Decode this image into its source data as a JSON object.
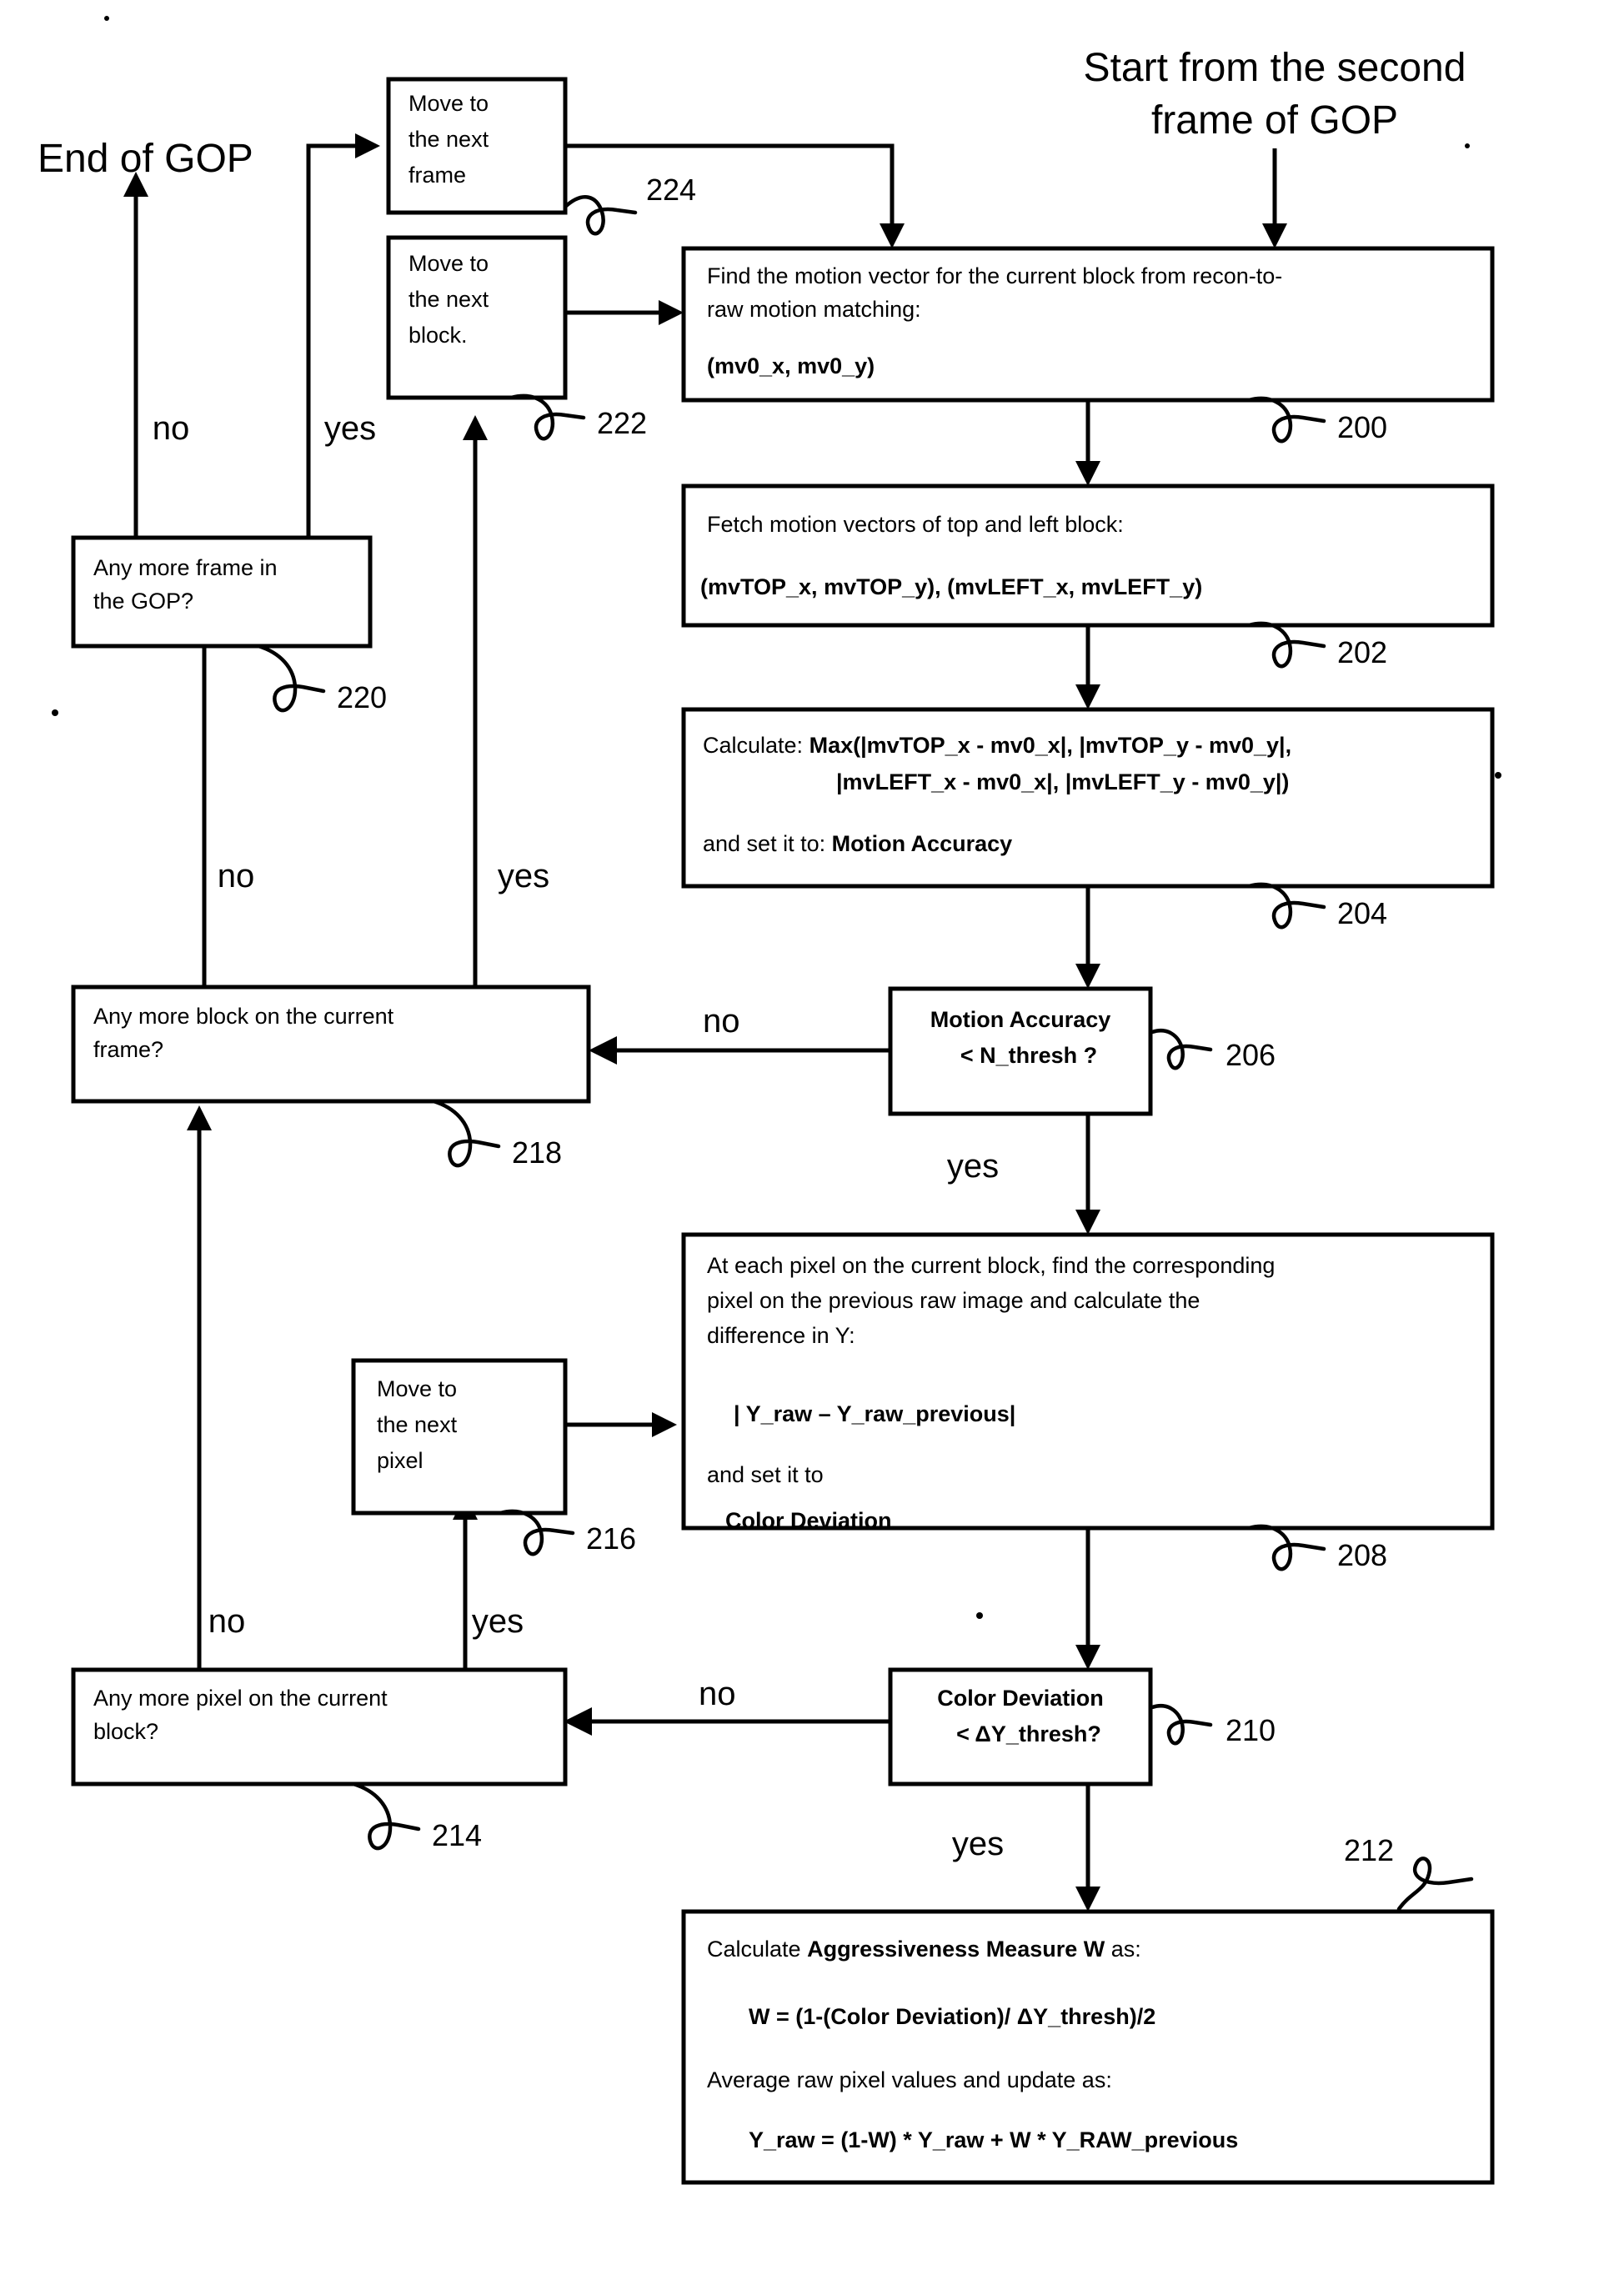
{
  "diagram": {
    "title_start": "Start from the second frame of GOP",
    "title_end": "End of GOP",
    "nodes": {
      "move_frame": {
        "ref": "224",
        "lines": [
          "Move to",
          "the next",
          "frame"
        ]
      },
      "move_block": {
        "ref": "222",
        "lines": [
          "Move to",
          "the next",
          "block."
        ]
      },
      "move_pixel": {
        "ref": "216",
        "lines": [
          "Move to",
          "the next",
          "pixel"
        ]
      },
      "step200": {
        "ref": "200",
        "lines": [
          "Find the motion vector for the current block from recon-to-",
          "raw motion matching:",
          "",
          "(mv0_x, mv0_y)"
        ]
      },
      "step202": {
        "ref": "202",
        "lines": [
          " Fetch motion vectors of top and left block:",
          "",
          "(mvTOP_x, mvTOP_y),  (mvLEFT_x, mvLEFT_y)"
        ]
      },
      "step204": {
        "ref": "204",
        "line1_plain": "Calculate:  ",
        "line1_bold": "Max(|mvTOP_x -  mv0_x|, |mvTOP_y - mv0_y|,",
        "line2_bold": "|mvLEFT_x -  mv0_x|, |mvLEFT_y - mv0_y|)",
        "line3_plain": " and set it to: ",
        "line3_bold": "Motion Accuracy"
      },
      "decision206": {
        "ref": "206",
        "line1": "Motion Accuracy",
        "line2": "<  N_thresh ?",
        "yes_label": "yes",
        "no_label": "no"
      },
      "step208": {
        "ref": "208",
        "line1": "At each pixel on the current block, find the corresponding",
        "line2": "pixel on the previous raw image and calculate the",
        "line3": "difference in Y:",
        "line4_bold": "| Y_raw – Y_raw_previous|",
        "line5": "and set it to",
        "line6_bold": "Color Deviation"
      },
      "decision210": {
        "ref": "210",
        "line1": "Color Deviation",
        "line2": "<  ΔY_thresh?",
        "yes_label": "yes",
        "no_label": "no"
      },
      "step212": {
        "ref": "212",
        "line1_plain": "Calculate ",
        "line1_bold": "Aggressiveness Measure W",
        "line1_tail": " as:",
        "line2_bold": "W = (1-(Color Deviation)/ ΔY_thresh)/2",
        "line3": "Average raw pixel values and update as:",
        "line4_bold": "Y_raw = (1-W) * Y_raw + W * Y_RAW_previous"
      },
      "decision214": {
        "ref": "214",
        "line1": "Any more pixel on the current",
        "line2": "block?",
        "yes_label": "yes",
        "no_label": "no"
      },
      "decision218": {
        "ref": "218",
        "line1": "Any more block on the current",
        "line2": "frame?",
        "yes_label": "yes",
        "no_label": "no"
      },
      "decision220": {
        "ref": "220",
        "line1": "Any more frame in",
        "line2": "the GOP?",
        "yes_label": "yes",
        "no_label": "no"
      }
    },
    "colors": {
      "stroke": "#000000",
      "fill": "#ffffff"
    }
  }
}
